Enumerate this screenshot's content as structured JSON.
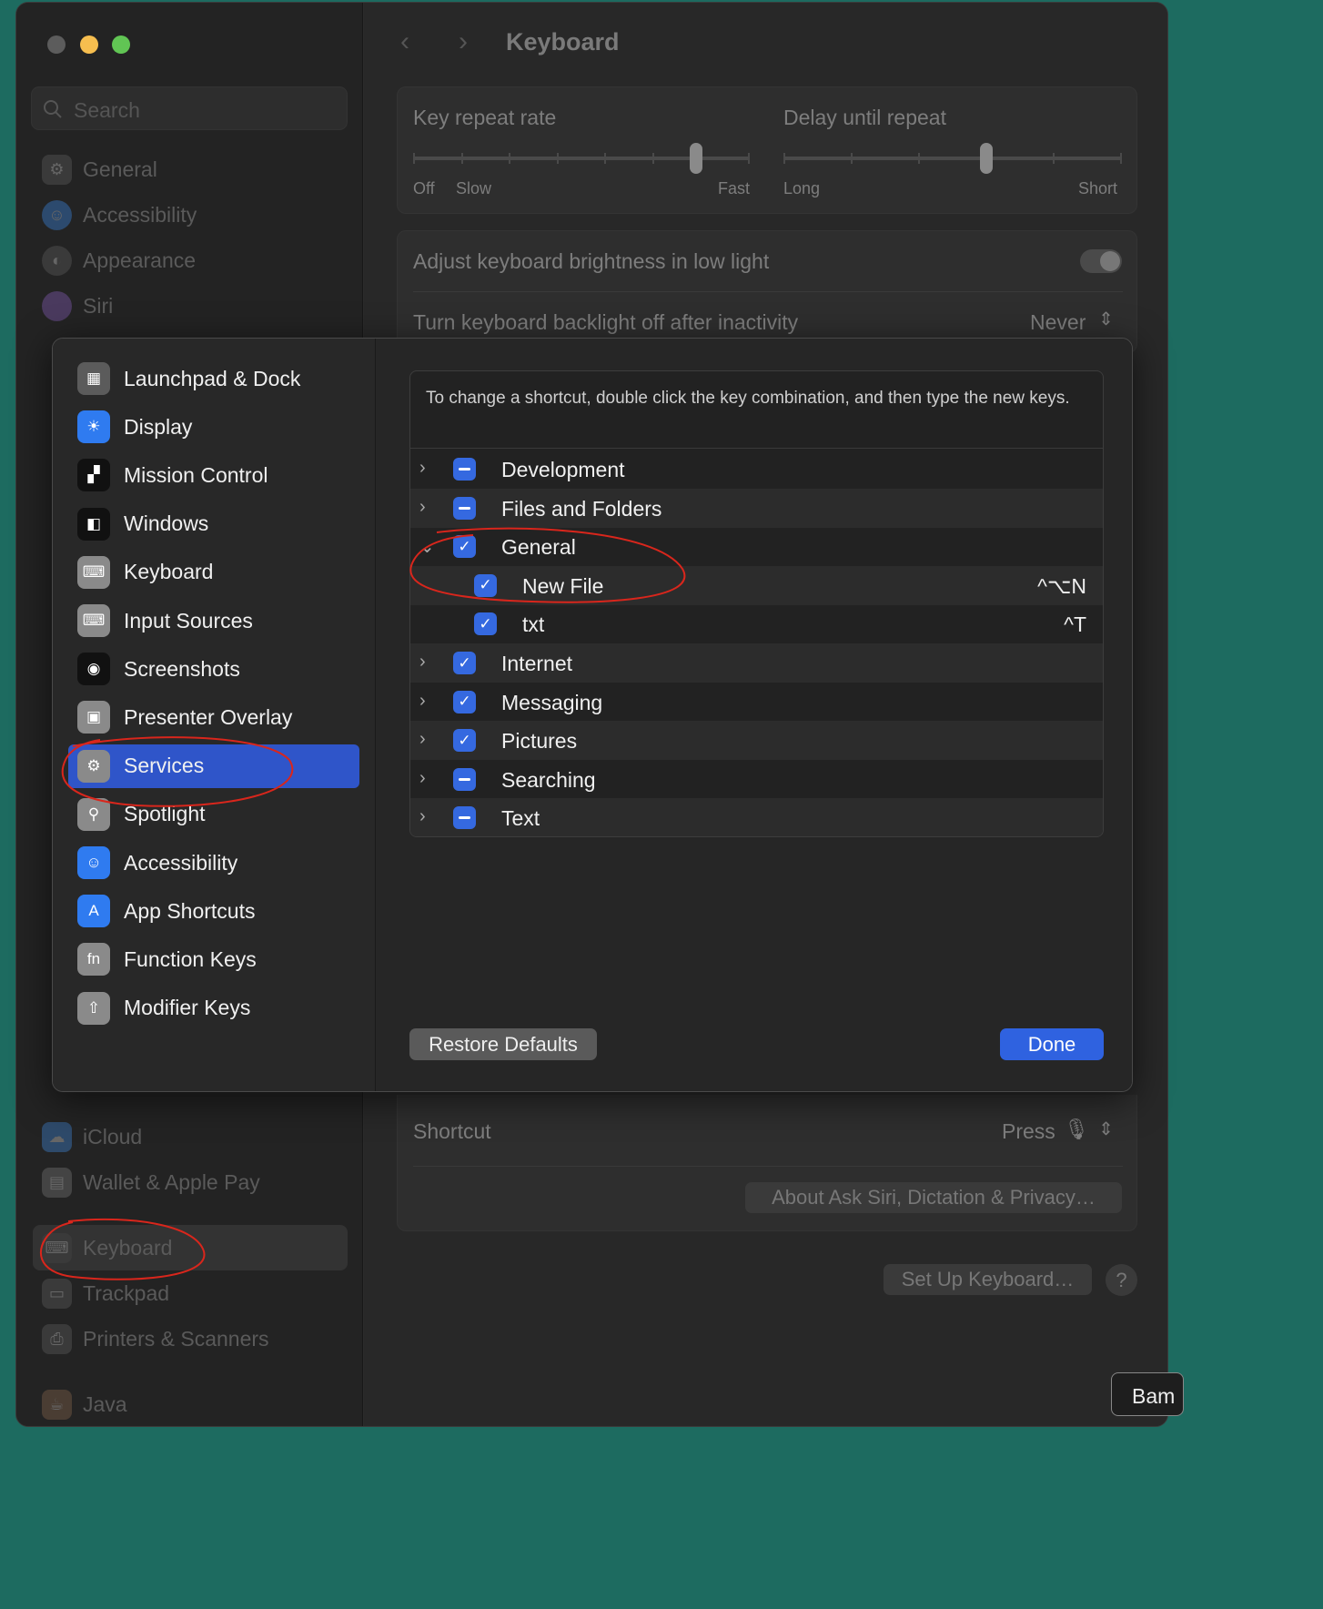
{
  "window": {
    "title": "Keyboard",
    "colors": {
      "close": "#5c5c5c",
      "minimize": "#f6be4f",
      "zoom": "#61c554",
      "accent": "#2f62e0"
    }
  },
  "sidebar": {
    "search_placeholder": "Search",
    "items_top": [
      {
        "label": "General",
        "icon": "gear-icon"
      },
      {
        "label": "Accessibility",
        "icon": "accessibility-icon"
      },
      {
        "label": "Appearance",
        "icon": "appearance-icon"
      },
      {
        "label": "Siri",
        "icon": "siri-icon"
      }
    ],
    "items_bottom": [
      {
        "label": "iCloud",
        "icon": "icloud-icon"
      },
      {
        "label": "Wallet & Apple Pay",
        "icon": "wallet-icon"
      },
      {
        "label": "Keyboard",
        "icon": "keyboard-icon",
        "selected": true
      },
      {
        "label": "Trackpad",
        "icon": "trackpad-icon"
      },
      {
        "label": "Printers & Scanners",
        "icon": "printer-icon"
      },
      {
        "label": "Java",
        "icon": "java-icon"
      }
    ]
  },
  "keyboard": {
    "key_repeat": {
      "label": "Key repeat rate",
      "min_label": "Off",
      "slow_label": "Slow",
      "max_label": "Fast",
      "value_fraction": 0.84
    },
    "delay": {
      "label": "Delay until repeat",
      "min_label": "Long",
      "max_label": "Short",
      "value_fraction": 0.6
    },
    "brightness_label": "Adjust keyboard brightness in low light",
    "backlight_label": "Turn keyboard backlight off after inactivity",
    "backlight_value": "Never",
    "shortcut_label": "Shortcut",
    "shortcut_value": "Press",
    "about_button": "About Ask Siri, Dictation & Privacy…",
    "setup_button": "Set Up Keyboard…",
    "help_button": "?"
  },
  "shortcuts_sheet": {
    "categories": [
      {
        "label": "Launchpad & Dock",
        "icon": "launchpad-icon"
      },
      {
        "label": "Display",
        "icon": "display-icon"
      },
      {
        "label": "Mission Control",
        "icon": "mission-control-icon"
      },
      {
        "label": "Windows",
        "icon": "windows-icon"
      },
      {
        "label": "Keyboard",
        "icon": "keyboard-icon"
      },
      {
        "label": "Input Sources",
        "icon": "input-sources-icon"
      },
      {
        "label": "Screenshots",
        "icon": "screenshot-icon"
      },
      {
        "label": "Presenter Overlay",
        "icon": "presenter-icon"
      },
      {
        "label": "Services",
        "icon": "services-icon",
        "selected": true
      },
      {
        "label": "Spotlight",
        "icon": "spotlight-icon"
      },
      {
        "label": "Accessibility",
        "icon": "accessibility-icon"
      },
      {
        "label": "App Shortcuts",
        "icon": "app-shortcuts-icon"
      },
      {
        "label": "Function Keys",
        "icon": "fn-icon",
        "glyph": "fn"
      },
      {
        "label": "Modifier Keys",
        "icon": "modifier-icon"
      }
    ],
    "instructions": "To change a shortcut, double click the key combination, and then type the new keys.",
    "rows": [
      {
        "label": "Development",
        "level": 0,
        "state": "mixed",
        "expanded": false
      },
      {
        "label": "Files and Folders",
        "level": 0,
        "state": "mixed",
        "expanded": false
      },
      {
        "label": "General",
        "level": 0,
        "state": "checked",
        "expanded": true
      },
      {
        "label": "New File",
        "level": 1,
        "state": "checked",
        "shortcut": "^⌥N"
      },
      {
        "label": "txt",
        "level": 1,
        "state": "checked",
        "shortcut": "^T"
      },
      {
        "label": "Internet",
        "level": 0,
        "state": "checked",
        "expanded": false
      },
      {
        "label": "Messaging",
        "level": 0,
        "state": "checked",
        "expanded": false
      },
      {
        "label": "Pictures",
        "level": 0,
        "state": "checked",
        "expanded": false
      },
      {
        "label": "Searching",
        "level": 0,
        "state": "mixed",
        "expanded": false
      },
      {
        "label": "Text",
        "level": 0,
        "state": "mixed",
        "expanded": false
      }
    ],
    "restore_button": "Restore Defaults",
    "done_button": "Done"
  },
  "background_window": {
    "partial_label": "Bam"
  }
}
